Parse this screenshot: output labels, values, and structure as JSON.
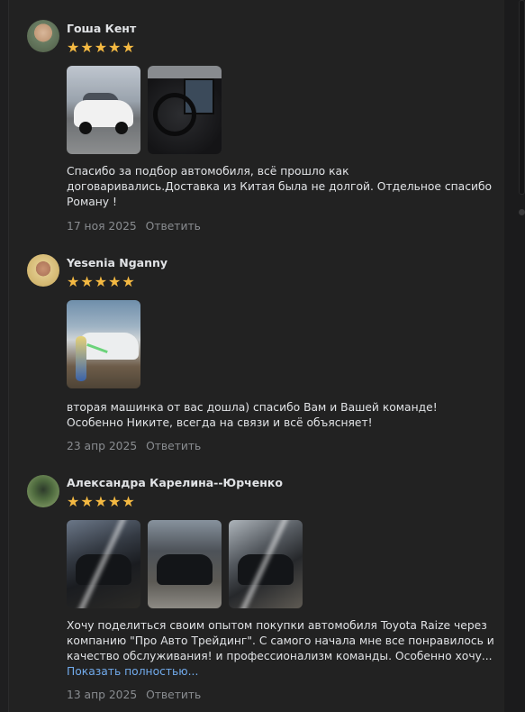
{
  "reviews": [
    {
      "author": "Гоша Кент",
      "rating": 5,
      "photos": [
        "white-car-photo",
        "car-interior-photo"
      ],
      "text": "Спасибо за подбор автомобиля, всё прошло как договаривались.Доставка из Китая была не долгой. Отдельное спасибо Роману !",
      "date": "17 ноя 2025",
      "reply_label": "Ответить"
    },
    {
      "author": "Yesenia Nganny",
      "rating": 5,
      "photos": [
        "car-washing-photo"
      ],
      "text": "вторая машинка от вас дошла) спасибо Вам и Вашей команде! Особенно Никите, всегда на связи и всё объясняет!",
      "date": "23 апр 2025",
      "reply_label": "Ответить"
    },
    {
      "author": "Александра Карелина--Юрченко",
      "rating": 5,
      "photos": [
        "dark-car-photo-1",
        "dark-car-photo-2",
        "dark-car-photo-3"
      ],
      "text": "Хочу поделиться своим опытом покупки автомобиля Toyota Raize через компанию \"Про Авто Трейдинг\". С самого начала мне все понравилось и качество обслуживания! и профессионализм команды. Особенно хочу...",
      "show_more": "Показать полностью...",
      "date": "13 апр 2025",
      "reply_label": "Ответить"
    }
  ],
  "colors": {
    "star": "#f4b942",
    "link": "#71aaeb",
    "meta": "#8a8d91",
    "background": "#222222"
  }
}
